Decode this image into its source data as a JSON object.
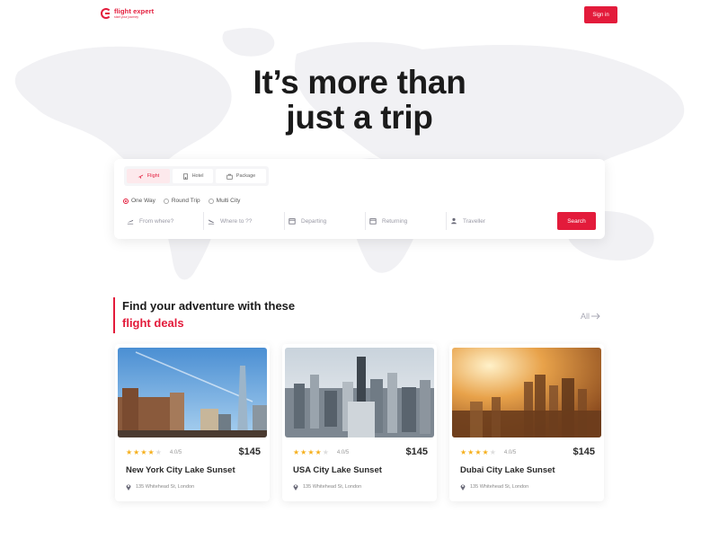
{
  "header": {
    "logo_name": "flight expert",
    "logo_tagline": "start your journey",
    "signin_label": "Sign in"
  },
  "hero": {
    "title_line1": "It’s more than",
    "title_line2": "just a trip"
  },
  "search": {
    "tabs": [
      {
        "label": "Flight",
        "icon": "plane-icon",
        "active": true
      },
      {
        "label": "Hotel",
        "icon": "hotel-icon",
        "active": false
      },
      {
        "label": "Package",
        "icon": "package-icon",
        "active": false
      }
    ],
    "trip_types": [
      {
        "label": "One Way",
        "selected": true
      },
      {
        "label": "Round Trip",
        "selected": false
      },
      {
        "label": "Multi City",
        "selected": false
      }
    ],
    "fields": [
      {
        "placeholder": "From where?",
        "icon": "plane-takeoff-icon"
      },
      {
        "placeholder": "Where to ??",
        "icon": "plane-landing-icon"
      },
      {
        "placeholder": "Departing",
        "icon": "calendar-icon"
      },
      {
        "placeholder": "Returning",
        "icon": "calendar-icon"
      },
      {
        "placeholder": "Traveller",
        "icon": "user-icon"
      }
    ],
    "search_label": "Search"
  },
  "deals": {
    "heading_line1": "Find your adventure with these",
    "heading_line2": "flight deals",
    "all_label": "All",
    "cards": [
      {
        "title": "New York City Lake Sunset",
        "rating": "4.0/5",
        "price": "$145",
        "address": "135 Whitehead St, London"
      },
      {
        "title": "USA City Lake Sunset",
        "rating": "4.0/5",
        "price": "$145",
        "address": "135 Whitehead St, London"
      },
      {
        "title": "Dubai City Lake Sunset",
        "rating": "4.0/5",
        "price": "$145",
        "address": "135 Whitehead St, London"
      }
    ]
  },
  "colors": {
    "accent": "#e31b3b",
    "text_dark": "#1b1b1b",
    "star": "#f6b01e"
  }
}
